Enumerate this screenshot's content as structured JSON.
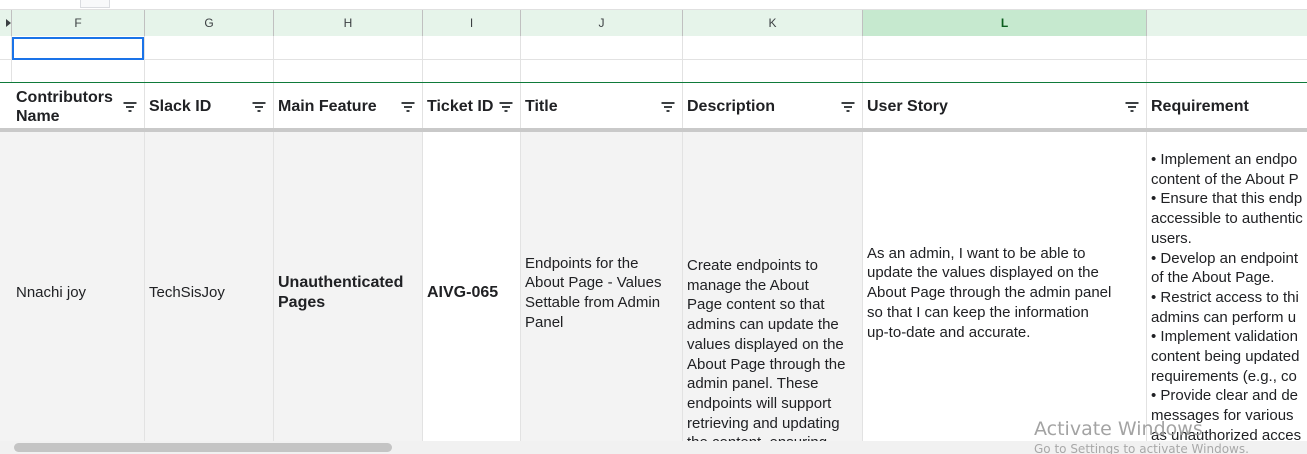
{
  "column_letters": [
    "F",
    "G",
    "H",
    "I",
    "J",
    "K",
    "L"
  ],
  "headers": {
    "contributors_name": "Contributors Name",
    "slack_id": "Slack ID",
    "main_feature": "Main Feature",
    "ticket_id": "Ticket ID",
    "title": "Title",
    "description": "Description",
    "user_story": "User Story",
    "requirement": "Requirement"
  },
  "row": {
    "contributors_name": "Nnachi joy",
    "slack_id": "TechSisJoy",
    "main_feature": "Unauthenticated\nPages",
    "ticket_id": "AIVG-065",
    "title": "Endpoints for the\nAbout Page - Values\nSettable from Admin\nPanel",
    "description": "Create endpoints to\nmanage the About\nPage content so that\nadmins can update the\nvalues displayed on the\nAbout Page through the\nadmin panel. These\nendpoints will support\nretrieving and updating\nthe content, ensuring",
    "user_story": "As an admin, I want to be able to\nupdate the values displayed on the\nAbout Page through the admin panel\nso that I can keep the information\nup-to-date and accurate.",
    "requirement_lines": [
      "• Implement an endpo",
      "content of the About P",
      "• Ensure that this endp",
      "accessible to authentic",
      "users.",
      "• Develop an endpoint",
      "of the About Page.",
      "• Restrict access to thi",
      "admins can perform u",
      "• Implement validation",
      "content being updated",
      "requirements (e.g., co",
      "• Provide clear and de",
      "messages for various",
      "as unauthorized acces"
    ]
  },
  "watermark": {
    "title": "Activate Windows",
    "subtitle": "Go to Settings to activate Windows."
  },
  "colors": {
    "active_column_header": "#c6e9cf",
    "column_header": "#e6f4ea",
    "selection": "#1a73e8",
    "row_fill": "#f3f3f3"
  }
}
